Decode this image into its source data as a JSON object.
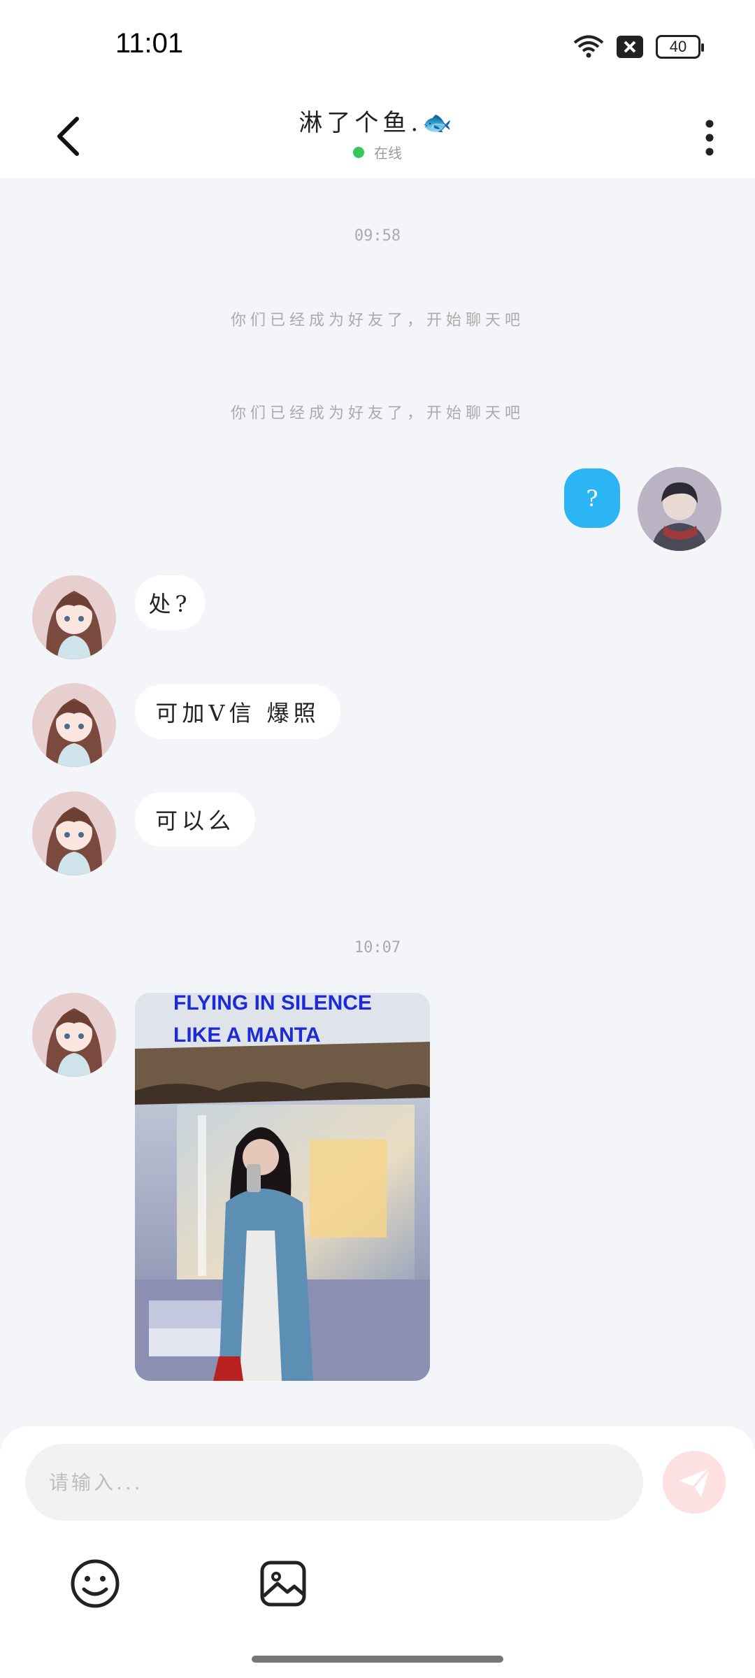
{
  "status_bar": {
    "time": "11:01",
    "battery": "40",
    "icons": [
      "wifi-icon",
      "signal-off-icon",
      "battery-icon"
    ]
  },
  "header": {
    "title": "淋了个鱼.🐟",
    "status": "在线",
    "status_color": "#34c759",
    "icons": [
      "back-arrow-icon",
      "more-vertical-icon"
    ]
  },
  "chat": {
    "timestamp_1": "09:58",
    "system_1": "你们已经成为好友了，开始聊天吧",
    "system_2": "你们已经成为好友了，开始聊天吧",
    "messages": [
      {
        "side": "right",
        "text": "?"
      },
      {
        "side": "left",
        "text": "处?"
      },
      {
        "side": "left",
        "text": "可加V信 爆照"
      },
      {
        "side": "left",
        "text": "可以么"
      }
    ],
    "timestamp_2": "10:07",
    "photo_sign_text": "FLYING IN SILENCE LIKE A MANTA"
  },
  "input": {
    "placeholder": "请输入...",
    "send_icon": "send-icon",
    "tools": [
      "emoji-icon",
      "image-icon"
    ]
  },
  "colors": {
    "accent_blue": "#2bb5f4",
    "background": "#f3f5f8",
    "send_button": "#fde0e0"
  }
}
